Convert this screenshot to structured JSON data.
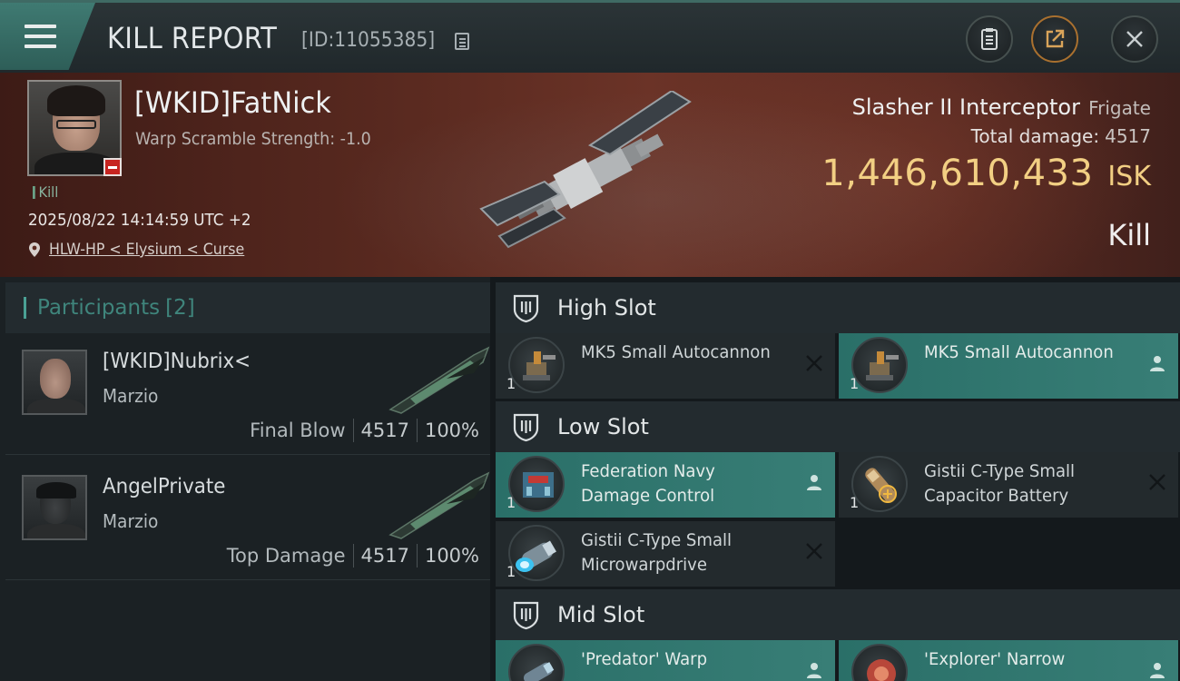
{
  "header": {
    "title": "KILL REPORT",
    "report_id": "[ID:11055385]"
  },
  "victim": {
    "name": "[WKID]FatNick",
    "scramble": "Warp Scramble Strength: -1.0",
    "tag": "Kill",
    "timestamp": "2025/08/22 14:14:59 UTC +2",
    "location": "HLW-HP < Elysium < Curse",
    "ship_name": "Slasher II Interceptor",
    "ship_class": "Frigate",
    "total_damage_label": "Total damage:",
    "total_damage": "4517",
    "isk_value": "1,446,610,433",
    "isk_unit": "ISK",
    "result": "Kill"
  },
  "participants": {
    "label": "Participants",
    "count": "[2]",
    "items": [
      {
        "name": "[WKID]Nubrix<",
        "corp": "Marzio",
        "role": "Final Blow",
        "damage": "4517",
        "percent": "100%"
      },
      {
        "name": "AngelPrivate",
        "corp": "Marzio",
        "role": "Top Damage",
        "damage": "4517",
        "percent": "100%"
      }
    ]
  },
  "slots": {
    "high": {
      "title": "High Slot",
      "modules": [
        {
          "qty": "1",
          "name": "MK5 Small Autocannon",
          "state": "destroyed",
          "icon": "autocannon-icon"
        },
        {
          "qty": "1",
          "name": "MK5 Small Autocannon",
          "state": "dropped",
          "icon": "autocannon-icon"
        }
      ]
    },
    "low": {
      "title": "Low Slot",
      "modules": [
        {
          "qty": "1",
          "name": "Federation Navy Damage Control",
          "state": "dropped",
          "icon": "damage-control-icon"
        },
        {
          "qty": "1",
          "name": "Gistii C-Type Small Capacitor Battery",
          "state": "destroyed",
          "icon": "capacitor-battery-icon"
        },
        {
          "qty": "1",
          "name": "Gistii C-Type Small Microwarpdrive",
          "state": "destroyed",
          "icon": "microwarpdrive-icon"
        }
      ]
    },
    "mid": {
      "title": "Mid Slot",
      "modules": [
        {
          "qty": "1",
          "name": "'Predator' Warp",
          "state": "dropped",
          "icon": "warp-disruptor-icon"
        },
        {
          "qty": "1",
          "name": "'Explorer' Narrow",
          "state": "dropped",
          "icon": "scanner-icon"
        }
      ]
    }
  },
  "colors": {
    "accent_teal": "#387e76",
    "isk_gold": "#f2cf83",
    "alert_red": "#c72420"
  }
}
